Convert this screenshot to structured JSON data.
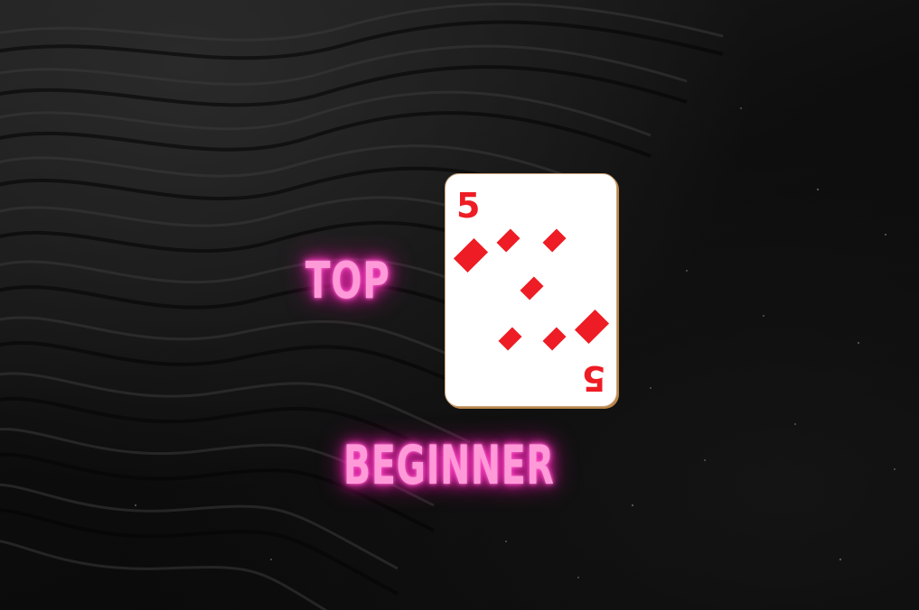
{
  "text": {
    "top": "TOP",
    "bottom": "BEGINNER"
  },
  "card": {
    "rank": "5",
    "suit": "diamond-icon",
    "suit_color": "#ee1c24"
  },
  "colors": {
    "neon_text": "#ff9ad8",
    "neon_glow": "#ff2ab8",
    "background": "#0b0b0b"
  }
}
